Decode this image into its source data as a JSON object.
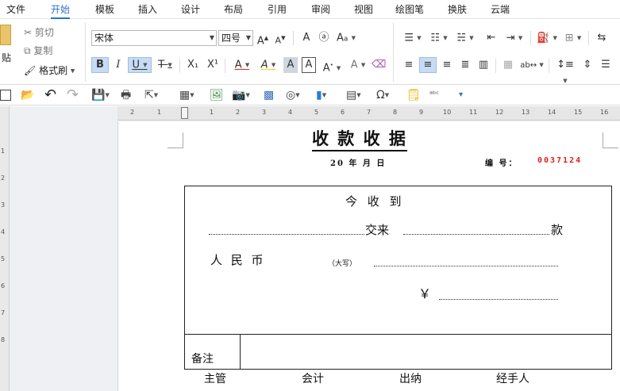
{
  "menu": {
    "items": [
      "文件",
      "开始",
      "模板",
      "插入",
      "设计",
      "布局",
      "引用",
      "审阅",
      "视图",
      "绘图笔",
      "换肤",
      "云端"
    ],
    "active": "开始"
  },
  "ribbon": {
    "paste_label": "贴",
    "cut_label": "剪切",
    "copy_label": "复制",
    "format_painter_label": "格式刷",
    "font_name": "宋体",
    "font_size": "四号",
    "bold": "B",
    "italic": "I",
    "underline": "U",
    "strike": "T",
    "subscript": "X₁",
    "superscript": "X¹",
    "font_color": "A",
    "highlight": "A",
    "char_shade": "A",
    "char_border": "A",
    "grow": "A",
    "shrink": "A",
    "phonetic": "A",
    "enclose": "a",
    "clear": "A"
  },
  "ruler": {
    "h_ticks": [
      "2",
      "1",
      "1",
      "2",
      "3",
      "4",
      "5",
      "6",
      "7",
      "8",
      "9",
      "10",
      "11",
      "12",
      "13",
      "14",
      "15",
      "16"
    ],
    "v_ticks": [
      "1",
      "2",
      "3",
      "4",
      "5",
      "6",
      "7",
      "8"
    ]
  },
  "document": {
    "title": "收  款  收  据",
    "date_line": "20  年   月   日",
    "number_label": "编 号：",
    "number_value": "0037124",
    "received_label": "今 收 到",
    "payment_from": "交来",
    "payment_suffix": "款",
    "rmb_label": "人 民 币",
    "uppercase_hint": "（大写）",
    "yen_sign": "￥",
    "note_label": "备注",
    "signatures": [
      "主管",
      "会计",
      "出纳",
      "经手人"
    ]
  },
  "colors": {
    "accent": "#2b72c9",
    "number_red": "#e0201b"
  }
}
